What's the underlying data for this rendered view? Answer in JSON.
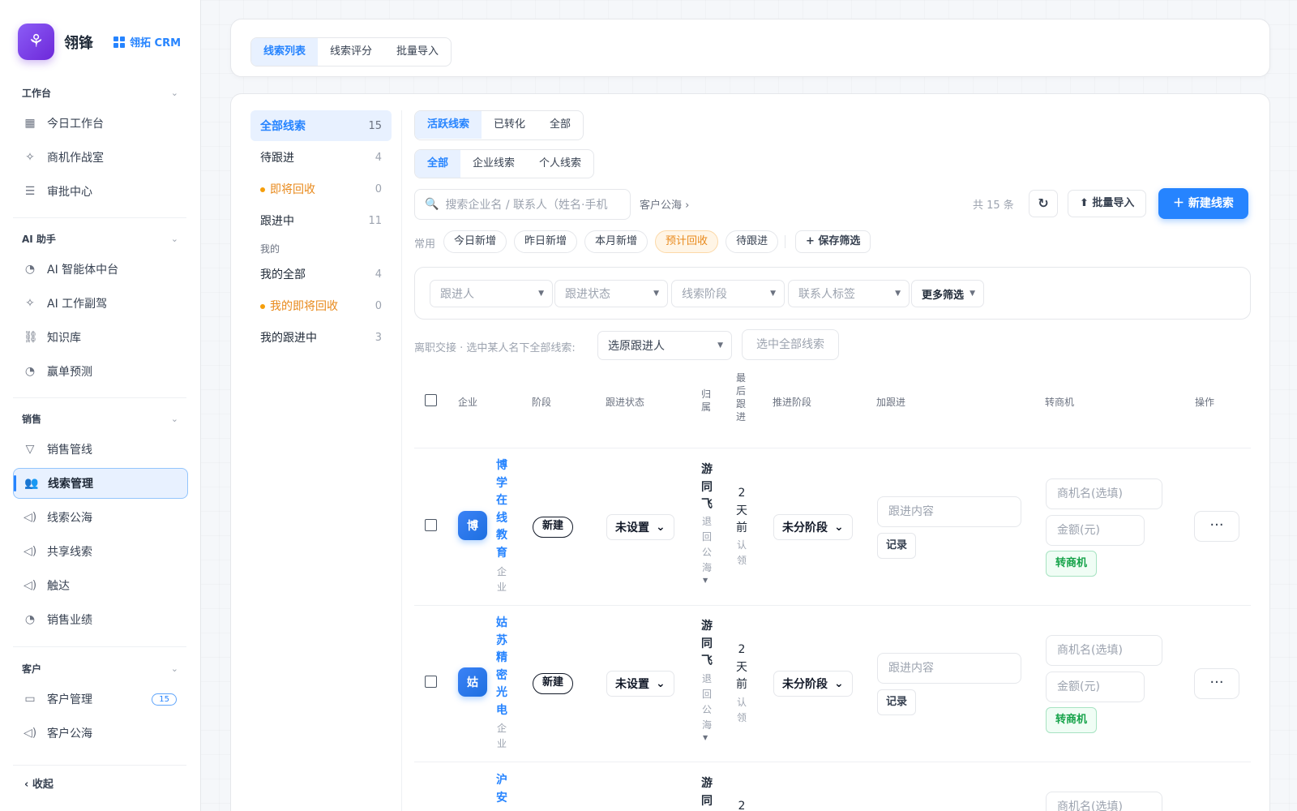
{
  "brand": {
    "name": "翎锋",
    "crm": "翎拓 CRM"
  },
  "sidebar": {
    "sections": [
      {
        "title": "工作台",
        "items": [
          {
            "label": "今日工作台",
            "icon": "grid-icon"
          },
          {
            "label": "商机作战室",
            "icon": "sparkle-icon"
          },
          {
            "label": "审批中心",
            "icon": "list-icon"
          }
        ]
      },
      {
        "title": "AI 助手",
        "items": [
          {
            "label": "AI 智能体中台",
            "icon": "gauge-icon"
          },
          {
            "label": "AI 工作副驾",
            "icon": "sparkle-icon"
          },
          {
            "label": "知识库",
            "icon": "link-icon"
          },
          {
            "label": "赢单预测",
            "icon": "gauge-icon"
          }
        ]
      },
      {
        "title": "销售",
        "items": [
          {
            "label": "销售管线",
            "icon": "filter-icon"
          },
          {
            "label": "线索管理",
            "icon": "users-icon"
          },
          {
            "label": "线索公海",
            "icon": "megaphone-icon"
          },
          {
            "label": "共享线索",
            "icon": "megaphone-icon"
          },
          {
            "label": "触达",
            "icon": "megaphone-icon"
          },
          {
            "label": "销售业绩",
            "icon": "gauge-icon"
          }
        ]
      },
      {
        "title": "客户",
        "items": [
          {
            "label": "客户管理",
            "icon": "card-icon",
            "count": "15"
          },
          {
            "label": "客户公海",
            "icon": "megaphone-icon"
          }
        ]
      }
    ],
    "collapse": "收起"
  },
  "toptabs": [
    "线索列表",
    "线索评分",
    "批量导入"
  ],
  "left_list": {
    "items": [
      {
        "label": "全部线索",
        "count": "15"
      },
      {
        "label": "待跟进",
        "count": "4"
      },
      {
        "label": "即将回收",
        "count": "0"
      },
      {
        "label": "跟进中",
        "count": "11"
      }
    ],
    "group": "我的",
    "mine": [
      {
        "label": "我的全部",
        "count": "4"
      },
      {
        "label": "我的即将回收",
        "count": "0"
      },
      {
        "label": "我的跟进中",
        "count": "3"
      }
    ]
  },
  "status_tabs": [
    "活跃线索",
    "已转化",
    "全部"
  ],
  "type_tabs": [
    "全部",
    "企业线索",
    "个人线索"
  ],
  "search": {
    "placeholder": "搜索企业名 / 联系人（姓名·手机",
    "pool_link": "客户公海 ›"
  },
  "total": "共 15 条",
  "buttons": {
    "batch_import": "批量导入",
    "new_lead": "新建线索",
    "save_filter": "保存筛选",
    "select_all": "选中全部线索"
  },
  "common": {
    "label": "常用",
    "chips": [
      "今日新增",
      "昨日新增",
      "本月新增",
      "预计回收",
      "待跟进"
    ]
  },
  "filters": {
    "owner": "跟进人",
    "status": "跟进状态",
    "stage": "线索阶段",
    "tag": "联系人标签",
    "more": "更多筛选"
  },
  "handover": {
    "label": "离职交接 · 选中某人名下全部线索:",
    "select": "选原跟进人"
  },
  "table": {
    "headers": {
      "company": "企业",
      "stage": "阶段",
      "status": "跟进状态",
      "owner": "归属",
      "last": "最后跟进",
      "push": "推进阶段",
      "add": "加跟进",
      "convert": "转商机",
      "ops": "操作"
    },
    "rows": [
      {
        "avatar": "博",
        "company": "博学在线教育",
        "kind": "企业",
        "stage": "新建",
        "status": "未设置",
        "owner": "游同飞",
        "owner_note": "退回公海",
        "last": "2天前",
        "last_note": "认领",
        "push": "未分阶段",
        "follow_ph": "跟进内容",
        "record": "记录",
        "opp_ph": "商机名(选填)",
        "amount_ph": "金额(元)",
        "convert": "转商机",
        "more": "···"
      },
      {
        "avatar": "姑",
        "company": "姑苏精密光电",
        "kind": "企业",
        "stage": "新建",
        "status": "未设置",
        "owner": "游同飞",
        "owner_note": "退回公海",
        "last": "2天前",
        "last_note": "认领",
        "push": "未分阶段",
        "follow_ph": "跟进内容",
        "record": "记录",
        "opp_ph": "商机名(选填)",
        "amount_ph": "金额(元)",
        "convert": "转商机",
        "more": "···"
      },
      {
        "company": "沪安",
        "owner": "游同",
        "last": "2",
        "opp_ph": "商机名(选填)"
      }
    ]
  },
  "colors": {
    "accent": "#2684ff",
    "warn": "#e8891b",
    "success": "#16a34a",
    "brand": "#7c3aed"
  }
}
